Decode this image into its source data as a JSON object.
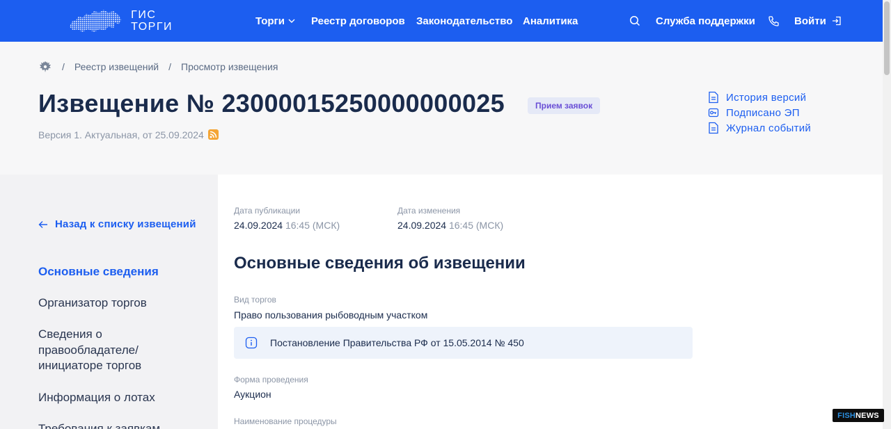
{
  "header": {
    "logo_line1": "ГИС",
    "logo_line2": "ТОРГИ",
    "nav": {
      "torgi": "Торги",
      "registry": "Реестр договоров",
      "law": "Законодательство",
      "analytics": "Аналитика",
      "support": "Служба поддержки",
      "login": "Войти"
    }
  },
  "breadcrumb": {
    "item1": "Реестр извещений",
    "item2": "Просмотр извещения",
    "separator": "/"
  },
  "notice": {
    "title": "Извещение № 23000015250000000025",
    "status": "Прием заявок",
    "version": "Версия 1. Актуальная, от 25.09.2024"
  },
  "side_links": [
    "История версий",
    "Подписано ЭП",
    "Журнал событий"
  ],
  "leftnav": {
    "back": "Назад к списку извещений",
    "items": [
      "Основные сведения",
      "Организатор торгов",
      "Сведения о правообладателе/ инициаторе торгов",
      "Информация о лотах",
      "Требования к заявкам"
    ]
  },
  "dates": {
    "pub_label": "Дата публикации",
    "pub_date": "24.09.2024",
    "pub_time": "16:45 (МСК)",
    "mod_label": "Дата изменения",
    "mod_date": "24.09.2024",
    "mod_time": "16:45 (МСК)"
  },
  "section": {
    "title": "Основные сведения об извещении",
    "kind_label": "Вид торгов",
    "kind_value": "Право пользования рыбоводным участком",
    "info_note": "Постановление Правительства РФ от 15.05.2014 № 450",
    "form_label": "Форма проведения",
    "form_value": "Аукцион",
    "proc_label": "Наименование процедуры"
  },
  "watermark": {
    "part1": "FISH",
    "part2": "NEWS"
  },
  "colors": {
    "accent": "#1c5ef0",
    "badge_bg": "#e5e9f7",
    "badge_text": "#6a4fd6",
    "rss": "#f4a535"
  }
}
